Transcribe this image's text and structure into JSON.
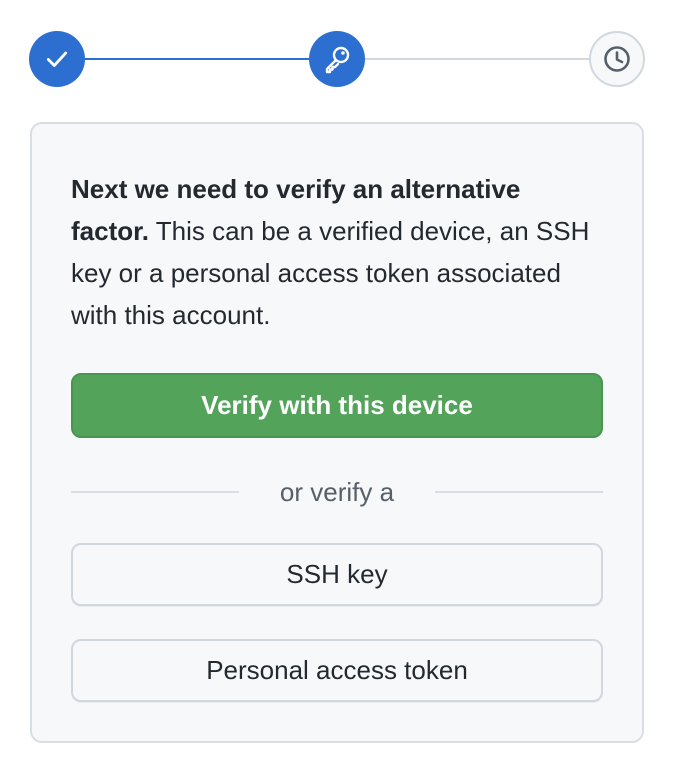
{
  "steps": [
    {
      "status": "complete",
      "icon": "check-icon"
    },
    {
      "status": "active",
      "icon": "key-icon"
    },
    {
      "status": "upcoming",
      "icon": "clock-icon"
    }
  ],
  "intro": {
    "bold": "Next we need to verify an alternative factor.",
    "text": " This can be a verified device, an SSH key or a personal access token associated with this account."
  },
  "buttons": {
    "verify_device": "Verify with this device",
    "ssh_key": "SSH key",
    "personal_access_token": "Personal access token"
  },
  "divider_text": "or verify a",
  "colors": {
    "accent_blue": "#2c6fd1",
    "primary_green": "#53a35b",
    "card_bg": "#f6f8fa"
  }
}
